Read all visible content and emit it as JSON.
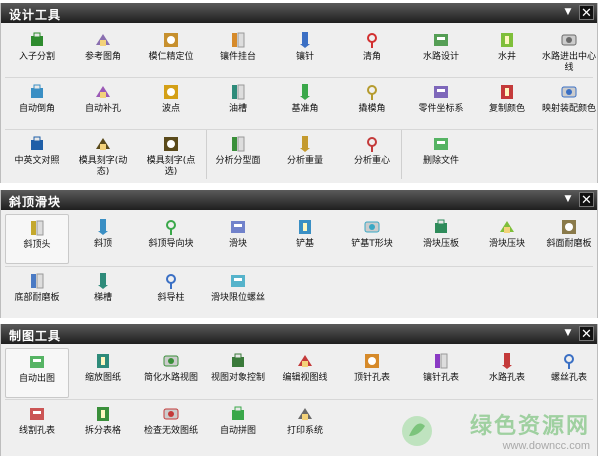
{
  "panels": [
    {
      "title": "设计工具",
      "tools": [
        {
          "label": "入子分割",
          "icon": "insert-split-icon",
          "color": "#2e8b2e"
        },
        {
          "label": "参考图角",
          "icon": "reference-corner-icon",
          "color": "#8a6fb0"
        },
        {
          "label": "模仁精定位",
          "icon": "core-locate-icon",
          "color": "#c7902e"
        },
        {
          "label": "镶件挂台",
          "icon": "insert-hanger-icon",
          "color": "#d68a2a"
        },
        {
          "label": "镶针",
          "icon": "pin-insert-icon",
          "color": "#3b6fc4"
        },
        {
          "label": "清角",
          "icon": "clear-corner-icon",
          "color": "#d23030"
        },
        {
          "label": "水路设计",
          "icon": "waterline-design-icon",
          "color": "#3a8f3a"
        },
        {
          "label": "水井",
          "icon": "water-well-icon",
          "color": "#7fbf3a"
        },
        {
          "label": "水路进出中心",
          "label2": "线",
          "icon": "waterline-center-icon",
          "color": "#6a6a6a"
        },
        {
          "label": "自动倒角",
          "icon": "auto-chamfer-icon",
          "color": "#3a8fc4"
        },
        {
          "label": "自动补孔",
          "icon": "auto-fill-hole-icon",
          "color": "#9b59b6"
        },
        {
          "label": "波点",
          "icon": "dot-icon",
          "color": "#d4a017"
        },
        {
          "label": "油槽",
          "icon": "oil-groove-icon",
          "color": "#2e8b7a"
        },
        {
          "label": "基准角",
          "icon": "datum-corner-icon",
          "color": "#3aa84a"
        },
        {
          "label": "撬模角",
          "icon": "pry-corner-icon",
          "color": "#b59b2e"
        },
        {
          "label": "零件坐标系",
          "icon": "part-csys-icon",
          "color": "#6a4fb0"
        },
        {
          "label": "复制颜色",
          "icon": "copy-color-icon",
          "color": "#c43a3a"
        },
        {
          "label": "映射装配颜色",
          "icon": "map-color-icon",
          "color": "#3a6fc4"
        },
        {
          "label": "中英文对照",
          "icon": "translate-icon",
          "color": "#1f5fa8"
        },
        {
          "label": "模具刻字(动",
          "label2": "态)",
          "icon": "engrave-dynamic-icon",
          "color": "#5a4a1a"
        },
        {
          "label": "模具刻字(点",
          "label2": "选)",
          "icon": "engrave-pick-icon",
          "color": "#5a4a1a"
        },
        {
          "label": "分析分型面",
          "icon": "analyze-parting-icon",
          "color": "#3a8f3a"
        },
        {
          "label": "分析重量",
          "icon": "analyze-weight-icon",
          "color": "#c49a2e"
        },
        {
          "label": "分析重心",
          "icon": "analyze-cog-icon",
          "color": "#c43a3a"
        },
        {
          "label": "删除文件",
          "icon": "delete-file-icon",
          "color": "#3aa84a"
        }
      ]
    },
    {
      "title": "斜顶滑块",
      "tools": [
        {
          "label": "斜顶头",
          "icon": "lifter-head-icon",
          "color": "#c4a82e"
        },
        {
          "label": "斜顶",
          "icon": "lifter-icon",
          "color": "#3a8fc4"
        },
        {
          "label": "斜顶导向块",
          "icon": "lifter-guide-icon",
          "color": "#3aa84a"
        },
        {
          "label": "滑块",
          "icon": "slider-icon",
          "color": "#5a6fc4"
        },
        {
          "label": "铲基",
          "icon": "wedge-base-icon",
          "color": "#3a8fc4"
        },
        {
          "label": "铲基T形块",
          "icon": "wedge-t-icon",
          "color": "#3aa8c4"
        },
        {
          "label": "滑块压板",
          "icon": "slider-clamp-icon",
          "color": "#2e8b5a"
        },
        {
          "label": "滑块压块",
          "icon": "slider-block-icon",
          "color": "#7fbf3a"
        },
        {
          "label": "斜面耐磨板",
          "icon": "wear-plate-icon",
          "color": "#8a7a4a"
        },
        {
          "label": "底部耐磨板",
          "icon": "bottom-wear-plate-icon",
          "color": "#4a7ac4"
        },
        {
          "label": "梯槽",
          "icon": "ladder-slot-icon",
          "color": "#2e8b7a"
        },
        {
          "label": "斜导柱",
          "icon": "angle-pin-icon",
          "color": "#3a6fc4"
        },
        {
          "label": "滑块限位螺丝",
          "icon": "limit-screw-icon",
          "color": "#3aa8c4"
        }
      ]
    },
    {
      "title": "制图工具",
      "tools": [
        {
          "label": "自动出图",
          "icon": "auto-drawing-icon",
          "color": "#3aa84a"
        },
        {
          "label": "缩放图纸",
          "icon": "scale-drawing-icon",
          "color": "#2e8b7a"
        },
        {
          "label": "简化水路视图",
          "icon": "simplify-waterline-icon",
          "color": "#3a8f3a"
        },
        {
          "label": "视图对象控制",
          "icon": "view-control-icon",
          "color": "#3a7a3a"
        },
        {
          "label": "编辑视图线",
          "icon": "edit-view-line-icon",
          "color": "#c43a3a"
        },
        {
          "label": "顶针孔表",
          "icon": "ejector-table-icon",
          "color": "#d68a2a"
        },
        {
          "label": "镶针孔表",
          "icon": "insert-pin-table-icon",
          "color": "#8a3ac4"
        },
        {
          "label": "水路孔表",
          "icon": "water-hole-table-icon",
          "color": "#c43a3a"
        },
        {
          "label": "螺丝孔表",
          "icon": "screw-table-icon",
          "color": "#3a6fc4"
        },
        {
          "label": "线割孔表",
          "icon": "wire-cut-table-icon",
          "color": "#c43a3a"
        },
        {
          "label": "拆分表格",
          "icon": "split-table-icon",
          "color": "#3a8f3a"
        },
        {
          "label": "检查无效图纸",
          "icon": "check-invalid-icon",
          "color": "#c43a3a"
        },
        {
          "label": "自动拼图",
          "icon": "auto-combine-icon",
          "color": "#3aa84a"
        },
        {
          "label": "打印系统",
          "icon": "print-icon",
          "color": "#6a6a6a"
        }
      ]
    }
  ],
  "watermark": {
    "brand": "绿色资源网",
    "url": "www.downcc.com"
  }
}
